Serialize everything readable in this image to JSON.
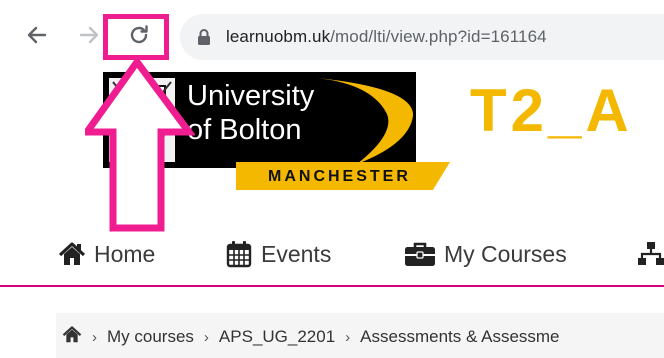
{
  "browser": {
    "url_domain": "learnuobm.uk",
    "url_path": "/mod/lti/view.php?id=161164",
    "icons": [
      "back-arrow-icon",
      "forward-arrow-icon",
      "reload-icon",
      "lock-icon"
    ]
  },
  "annotation": {
    "highlight_color": "#ef1d8f",
    "arrow_color": "#ef1d8f"
  },
  "logo": {
    "line1": "University",
    "line2": "of Bolton",
    "campus": "MANCHESTER"
  },
  "page_title": "T2_A",
  "colors": {
    "brand_yellow": "#f5b800",
    "nav_rule": "#d9007e"
  },
  "nav": {
    "home": "Home",
    "events": "Events",
    "my_courses": "My Courses"
  },
  "breadcrumb": {
    "items": [
      "My courses",
      "APS_UG_2201",
      "Assessments & Assessme"
    ]
  }
}
